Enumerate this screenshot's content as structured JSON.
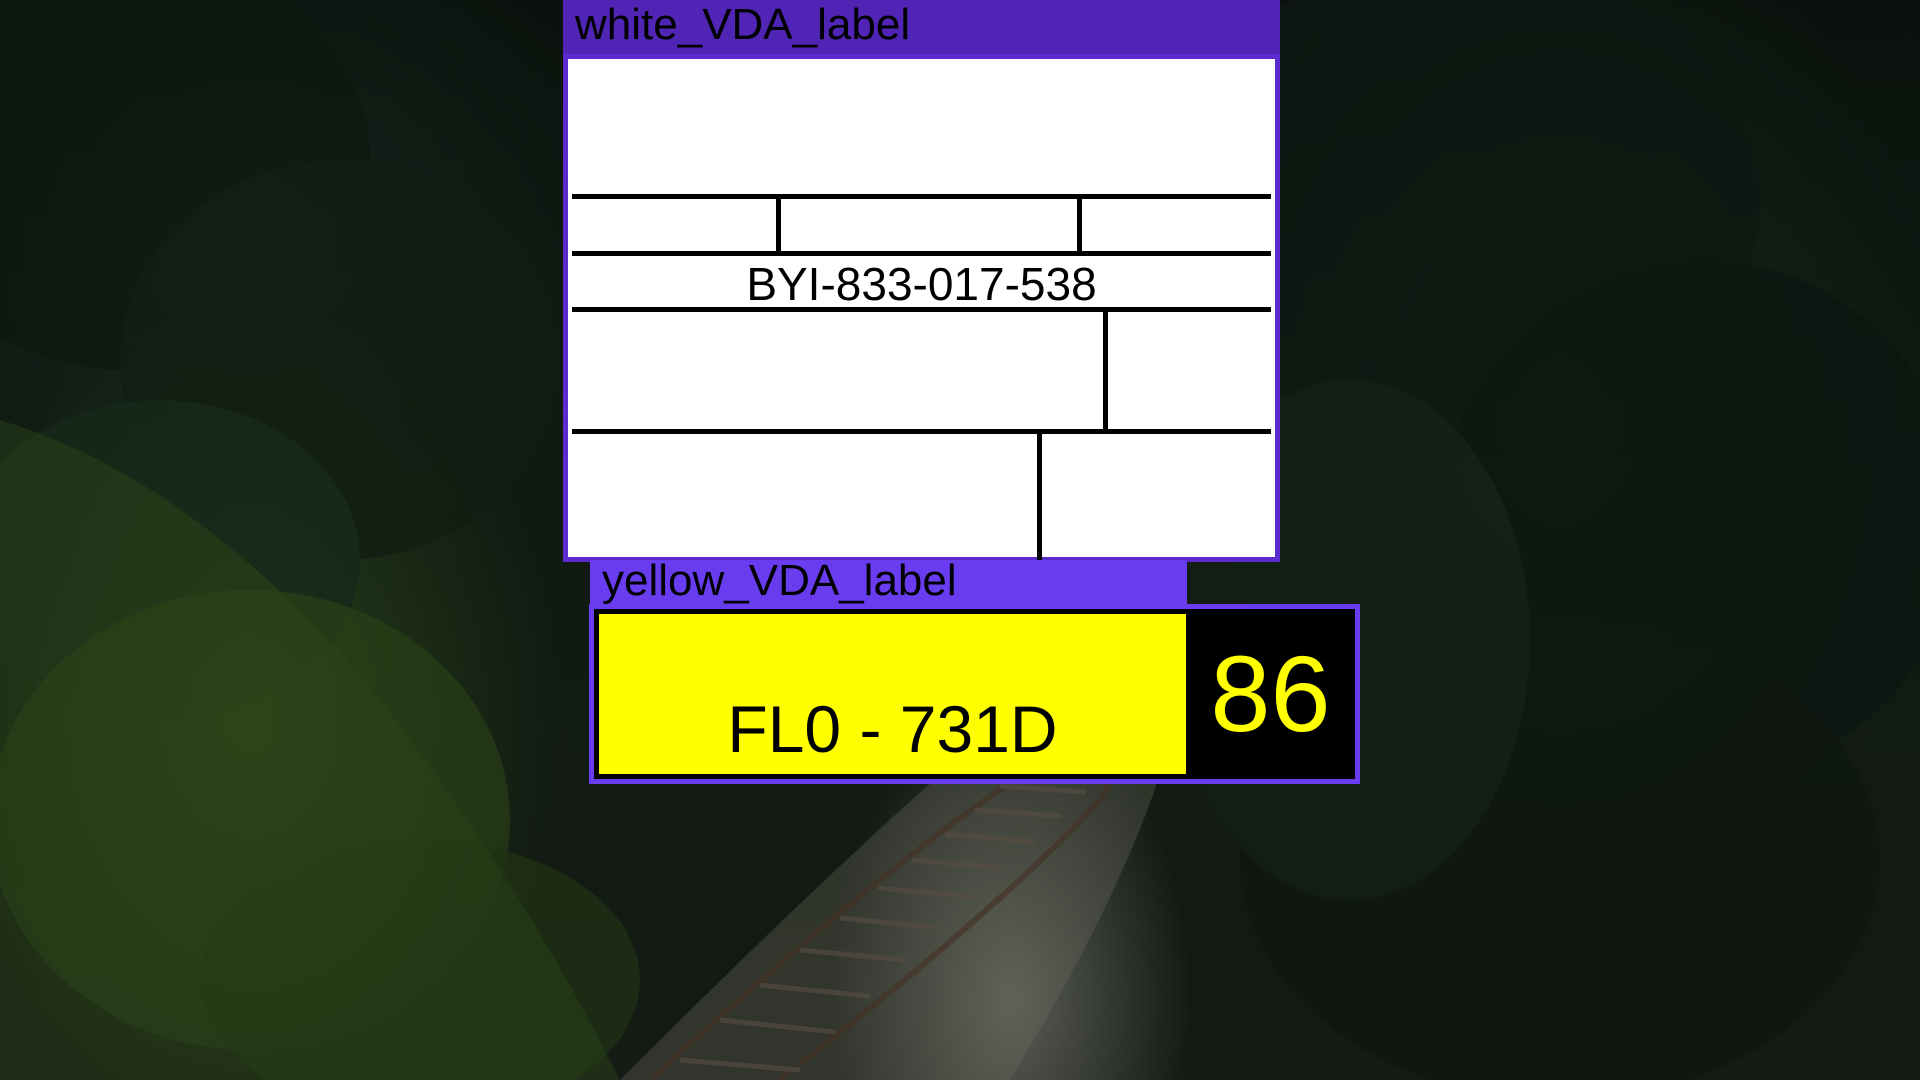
{
  "white_label": {
    "tag": "white_VDA_label",
    "code": "BYI-833-017-538",
    "tag_color": "#5024b4",
    "border_color": "#5b2bd0"
  },
  "yellow_label": {
    "tag": "yellow_VDA_label",
    "plate": "FL0 - 731D",
    "number": "86",
    "tag_color": "#6a3cf0",
    "plate_color": "#ffff00"
  }
}
